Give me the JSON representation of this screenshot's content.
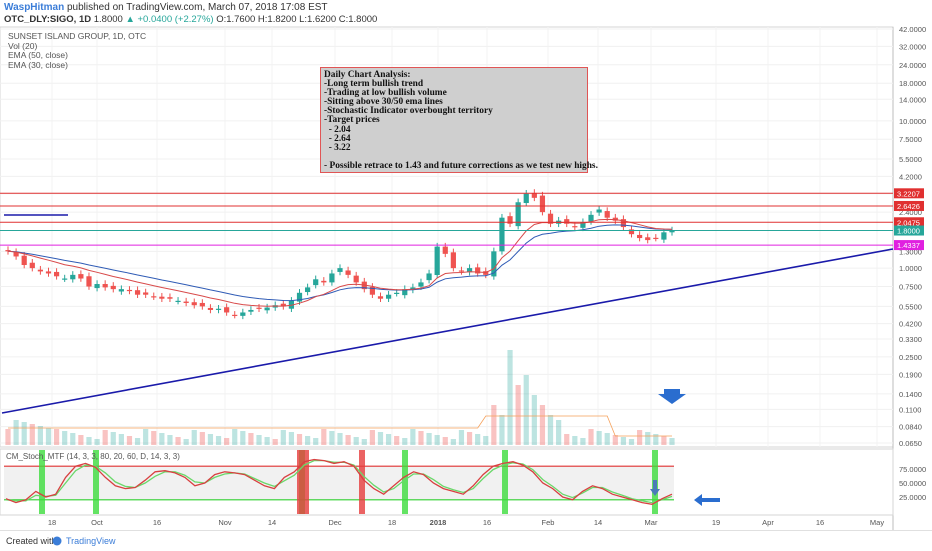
{
  "header": {
    "user": "WaspHitman",
    "published": " published on TradingView.com, March 07, 2018 17:08 EST",
    "symbol": "OTC_DLY:SIGO, 1D",
    "last": "1.8000",
    "change": "▲ +0.0400 (+2.27%)",
    "ohlc": " O:1.7600 H:1.8200 L:1.6200 C:1.8000"
  },
  "legend": {
    "title": "SUNSET ISLAND GROUP, 1D, OTC",
    "vol": "Vol (20)",
    "ema50": "EMA (50, close)",
    "ema30": "EMA (30, close)"
  },
  "annotation": {
    "lines": [
      "Daily Chart Analysis:",
      "-Long term bullish trend",
      "-Trading at low bullish volume",
      "-Sitting above 30/50 ema lines",
      "-Stochastic Indicator overbought territory",
      "-Target prices",
      "  - 2.04",
      "  - 2.64",
      "  - 3.22",
      "",
      "- Possible retrace to 1.43 and future corrections as we test new highs."
    ]
  },
  "stoch_label": "CM_Stoch_MTF (14, 3, 3, 80, 20, 60, D, 14, 3, 3)",
  "footer": {
    "created": "Created with",
    "brand": "TradingView"
  },
  "colors": {
    "bull": "#26a69a",
    "bear": "#ef5350",
    "ema50": "#2f5bb5",
    "ema30": "#d84a4a",
    "trend": "#1a1aaa"
  },
  "chart_data": {
    "type": "candlestick",
    "price_axis": {
      "scale": "log",
      "ticks": [
        "42.0000",
        "32.0000",
        "24.0000",
        "18.0000",
        "14.0000",
        "10.0000",
        "7.5000",
        "5.5000",
        "4.2000",
        "3.2000",
        "2.4000",
        "1.8000",
        "1.3000",
        "1.0000",
        "0.7500",
        "0.5500",
        "0.4200",
        "0.3300",
        "0.2500",
        "0.1900",
        "0.1400",
        "0.1100",
        "0.0840",
        "0.0650"
      ]
    },
    "time_axis": {
      "ticks": [
        "18",
        "Oct",
        "16",
        "Nov",
        "14",
        "Dec",
        "18",
        "2018",
        "16",
        "Feb",
        "14",
        "Mar",
        "19",
        "Apr",
        "16",
        "May"
      ]
    },
    "horizontal_levels": [
      {
        "label": "3.2207",
        "value": 3.2207,
        "color": "#e03030"
      },
      {
        "label": "2.6426",
        "value": 2.6426,
        "color": "#e03030"
      },
      {
        "label": "2.0475",
        "value": 2.0475,
        "color": "#e03030"
      },
      {
        "label": "1.8000",
        "value": 1.8,
        "color": "#26a69a"
      },
      {
        "label": "1.4337",
        "value": 1.4337,
        "color": "#e020e0"
      }
    ],
    "close_path": [
      1.3,
      1.2,
      1.05,
      1.0,
      0.95,
      0.92,
      0.88,
      0.85,
      0.9,
      0.85,
      0.75,
      0.78,
      0.74,
      0.72,
      0.72,
      0.7,
      0.66,
      0.66,
      0.64,
      0.62,
      0.62,
      0.6,
      0.58,
      0.56,
      0.55,
      0.52,
      0.53,
      0.5,
      0.48,
      0.5,
      0.52,
      0.53,
      0.54,
      0.56,
      0.55,
      0.6,
      0.68,
      0.74,
      0.84,
      0.8,
      0.92,
      1.0,
      0.9,
      0.8,
      0.72,
      0.66,
      0.62,
      0.66,
      0.68,
      0.72,
      0.74,
      0.8,
      0.92,
      1.4,
      1.25,
      1.0,
      0.95,
      1.0,
      0.92,
      0.9,
      1.3,
      2.2,
      2.0,
      2.8,
      3.2,
      3.0,
      2.4,
      2.0,
      2.1,
      2.0,
      1.9,
      2.05,
      2.3,
      2.5,
      2.2,
      2.1,
      1.9,
      1.7,
      1.6,
      1.55,
      1.6,
      1.75,
      1.8
    ],
    "stochastic": {
      "ticks": [
        "75.0000",
        "50.0000",
        "25.0000"
      ],
      "levels": [
        80,
        20
      ],
      "k": [
        22,
        15,
        20,
        35,
        25,
        30,
        60,
        80,
        85,
        78,
        60,
        45,
        40,
        42,
        55,
        70,
        72,
        68,
        60,
        45,
        50,
        65,
        70,
        68,
        65,
        55,
        45,
        40,
        60,
        70,
        88,
        92,
        90,
        85,
        88,
        80,
        55,
        40,
        30,
        45,
        60,
        70,
        65,
        50,
        40,
        35,
        30,
        45,
        65,
        80,
        85,
        88,
        82,
        70,
        50,
        40,
        25,
        20,
        35,
        45,
        40,
        30,
        25,
        20,
        15,
        12,
        22,
        30
      ],
      "d": [
        20,
        18,
        18,
        28,
        26,
        28,
        50,
        72,
        82,
        80,
        68,
        52,
        44,
        42,
        50,
        62,
        70,
        70,
        64,
        52,
        50,
        60,
        66,
        68,
        66,
        58,
        50,
        44,
        54,
        64,
        82,
        90,
        90,
        87,
        87,
        82,
        62,
        46,
        34,
        40,
        54,
        66,
        66,
        56,
        44,
        38,
        33,
        40,
        58,
        74,
        82,
        86,
        84,
        74,
        56,
        44,
        30,
        24,
        32,
        42,
        42,
        34,
        28,
        22,
        18,
        15,
        20,
        26
      ]
    }
  }
}
